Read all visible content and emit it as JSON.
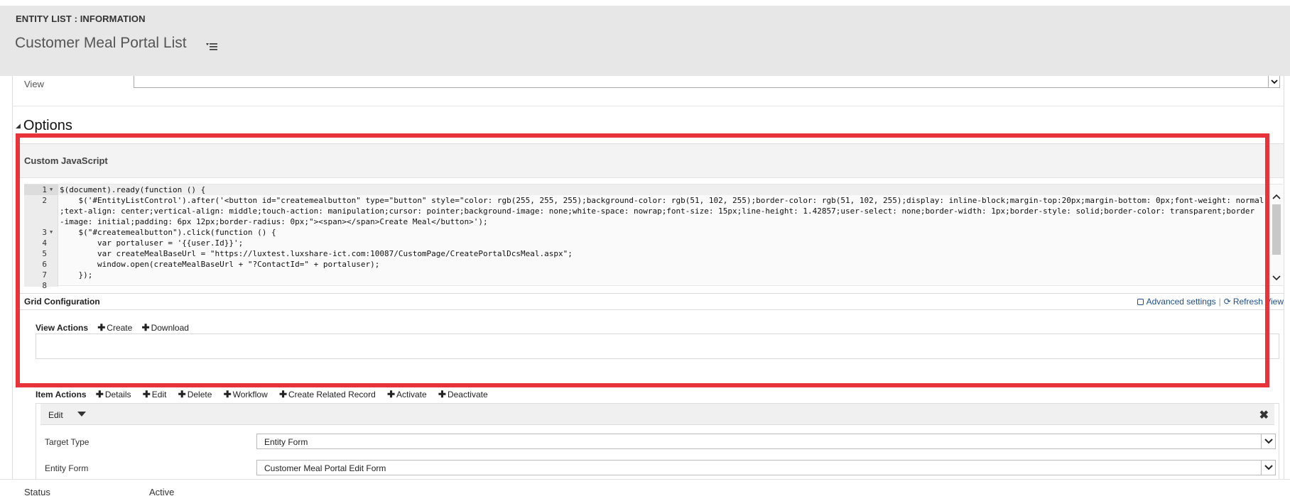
{
  "header": {
    "entity_label": "ENTITY LIST : INFORMATION",
    "title": "Customer Meal Portal List"
  },
  "view_field": {
    "label": "View",
    "value": ""
  },
  "options": {
    "title": "Options",
    "custom_js": {
      "title": "Custom JavaScript",
      "line_numbers": [
        "1",
        "2",
        "",
        "",
        "3",
        "4",
        "5",
        "6",
        "7",
        "8"
      ],
      "lines": [
        "$(document).ready(function () {",
        "    $('#EntityListControl').after('<button id=\"createmealbutton\" type=\"button\" style=\"color: rgb(255, 255, 255);background-color: rgb(51, 102, 255);border-color: rgb(51, 102, 255);display: inline-block;margin-top:20px;margin-bottom: 0px;font-weight: normal",
        ";text-align: center;vertical-align: middle;touch-action: manipulation;cursor: pointer;background-image: none;white-space: nowrap;font-size: 15px;line-height: 1.42857;user-select: none;border-width: 1px;border-style: solid;border-color: transparent;border",
        "-image: initial;padding: 6px 12px;border-radius: 0px;\"><span></span>Create Meal</button>');",
        "    $(\"#createmealbutton\").click(function () {",
        "        var portaluser = '{{user.Id}}';",
        "        var createMealBaseUrl = \"https://luxtest.luxshare-ict.com:10087/CustomPage/CreatePortalDcsMeal.aspx\";",
        "        window.open(createMealBaseUrl + \"?ContactId=\" + portaluser);",
        "    });",
        ""
      ]
    }
  },
  "grid_config": {
    "title": "Grid Configuration",
    "advanced_settings": "Advanced settings",
    "refresh_view": "Refresh View",
    "view_actions": {
      "title": "View Actions",
      "items": [
        "Create",
        "Download"
      ]
    },
    "item_actions": {
      "title": "Item Actions",
      "items": [
        "Details",
        "Edit",
        "Delete",
        "Workflow",
        "Create Related Record",
        "Activate",
        "Deactivate"
      ]
    },
    "edit_panel": {
      "title": "Edit",
      "target_type_label": "Target Type",
      "target_type_value": "Entity Form",
      "entity_form_label": "Entity Form",
      "entity_form_value": "Customer Meal Portal Edit Form"
    }
  },
  "status": {
    "label": "Status",
    "value": "Active"
  },
  "colors": {
    "highlight": "#e8333b",
    "link": "#1e4e8c",
    "header_bg": "#e7e7e7"
  }
}
